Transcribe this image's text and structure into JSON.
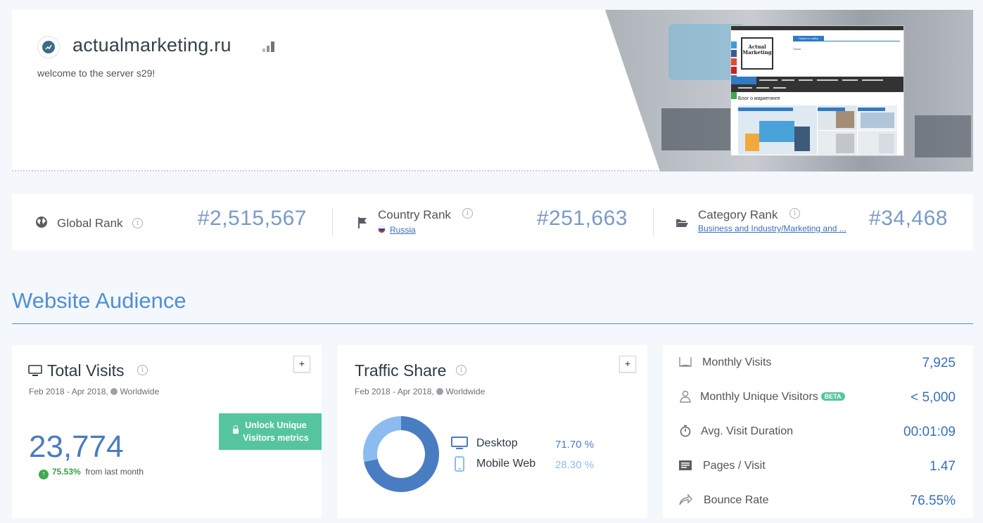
{
  "site": {
    "name": "actualmarketing.ru",
    "description": "welcome to the server s29!"
  },
  "ranks": {
    "global": {
      "label": "Global Rank",
      "value": "#2,515,567"
    },
    "country": {
      "label": "Country Rank",
      "sub": "Russia",
      "value": "#251,663"
    },
    "category": {
      "label": "Category Rank",
      "sub": "Business and Industry/Marketing and ...",
      "value": "#34,468"
    }
  },
  "audience": {
    "title": "Website Audience",
    "total_visits": {
      "title": "Total Visits",
      "period": "Feb 2018 - Apr 2018,",
      "region": "Worldwide",
      "value": "23,774",
      "change": "75.53%",
      "change_suffix": "from last month",
      "unlock_label": "Unlock Unique Visitors metrics",
      "plus": "+"
    },
    "traffic_share": {
      "title": "Traffic Share",
      "period": "Feb 2018 - Apr 2018,",
      "region": "Worldwide",
      "plus": "+",
      "items": [
        {
          "label": "Desktop",
          "value": "71.70 %",
          "fraction": 0.717,
          "color": "#4a7cc2"
        },
        {
          "label": "Mobile Web",
          "value": "28.30 %",
          "fraction": 0.283,
          "color": "#8cbcef"
        }
      ]
    },
    "metrics": [
      {
        "label": "Monthly Visits",
        "value": "7,925",
        "icon": "book-icon"
      },
      {
        "label": "Monthly Unique Visitors",
        "badge": "BETA",
        "value": "< 5,000",
        "icon": "user-icon"
      },
      {
        "label": "Avg. Visit Duration",
        "value": "00:01:09",
        "icon": "stopwatch-icon"
      },
      {
        "label": "Pages / Visit",
        "value": "1.47",
        "icon": "pages-icon"
      },
      {
        "label": "Bounce Rate",
        "value": "76.55%",
        "icon": "bounce-arrow-icon"
      }
    ]
  },
  "preview": {
    "search_button": "Поиск по сайту",
    "search_label": "Поиск",
    "logo_line1": "Actual",
    "logo_line2": "Marketing",
    "blog_title": "Блог о маркетинге"
  }
}
